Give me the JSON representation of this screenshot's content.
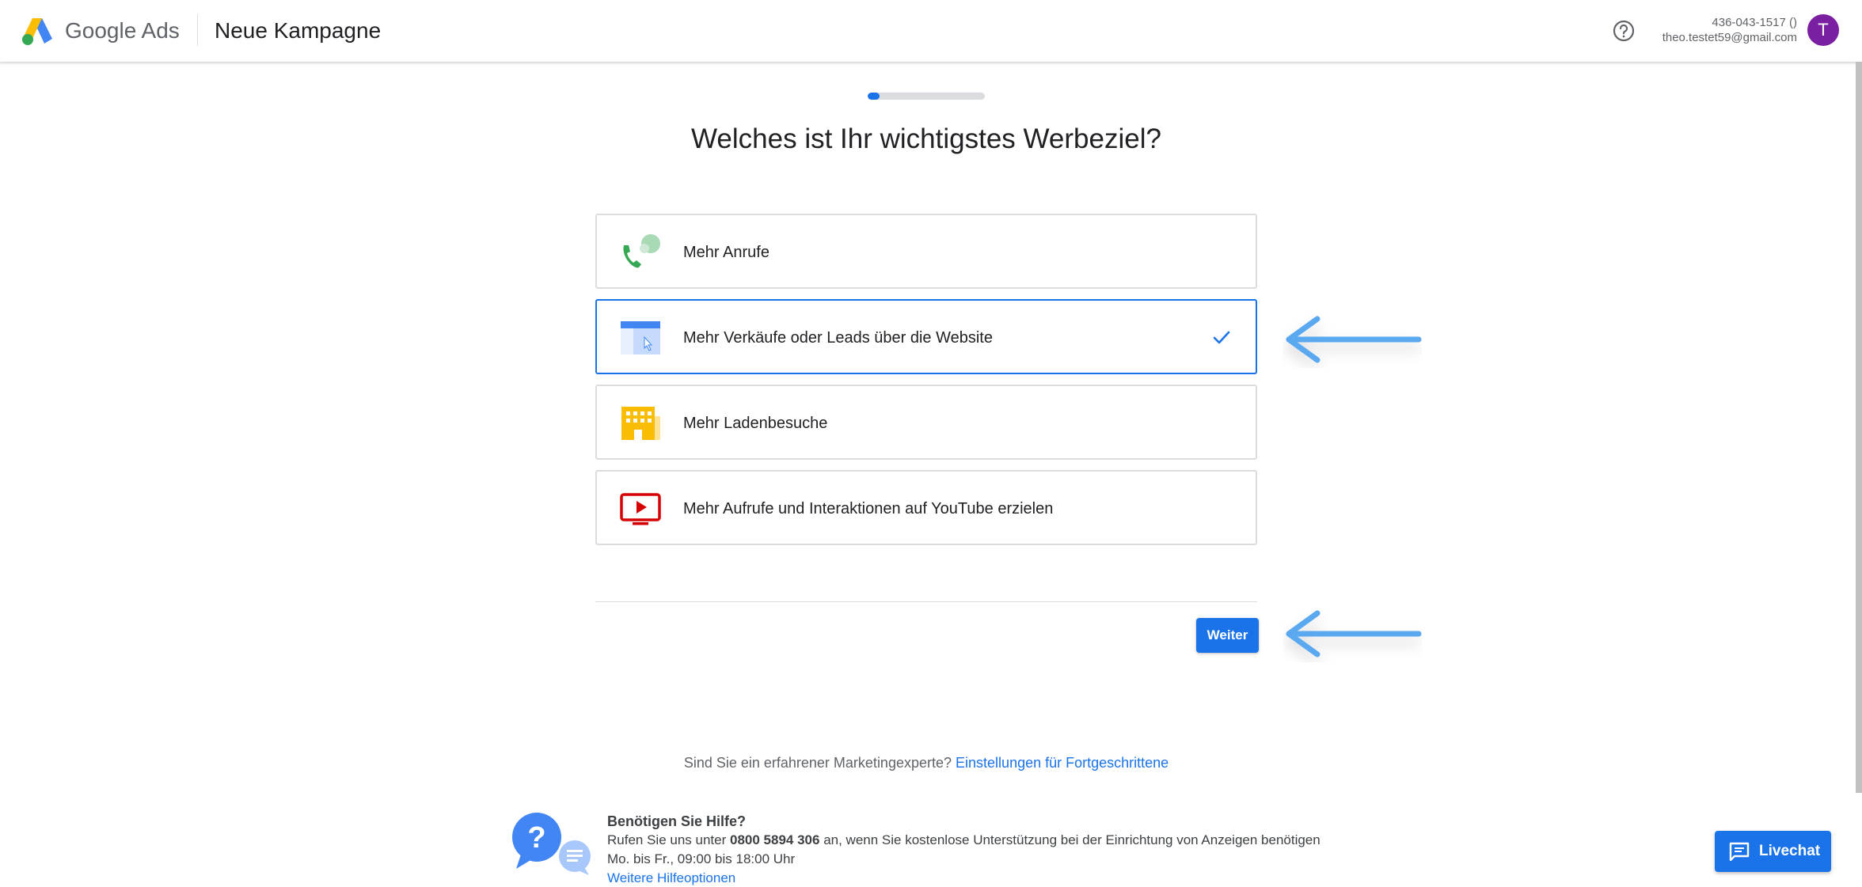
{
  "header": {
    "brand_google": "Google",
    "brand_ads": "Ads",
    "title": "Neue Kampagne",
    "account_id": "436-043-1517 ()",
    "account_email": "theo.testet59@gmail.com",
    "avatar_letter": "T"
  },
  "progress": {
    "step_fraction": 0.1
  },
  "question": "Welches ist Ihr wichtigstes Werbeziel?",
  "options": [
    {
      "label": "Mehr Anrufe",
      "icon": "phone-call-icon",
      "selected": false
    },
    {
      "label": "Mehr Verkäufe oder Leads über die Website",
      "icon": "website-cursor-icon",
      "selected": true
    },
    {
      "label": "Mehr Ladenbesuche",
      "icon": "store-building-icon",
      "selected": false
    },
    {
      "label": "Mehr Aufrufe und Interaktionen auf YouTube erzielen",
      "icon": "youtube-play-icon",
      "selected": false
    }
  ],
  "actions": {
    "next_label": "Weiter"
  },
  "advanced": {
    "prompt": "Sind Sie ein erfahrener Marketingexperte?",
    "link": "Einstellungen für Fortgeschrittene"
  },
  "help": {
    "title": "Benötigen Sie Hilfe?",
    "line1_prefix": "Rufen Sie uns unter",
    "phone": "0800 5894 306",
    "line1_suffix": "an, wenn Sie kostenlose Unterstützung bei der Einrichtung von Anzeigen benötigen",
    "hours": "Mo. bis Fr., 09:00 bis 18:00 Uhr",
    "more_link": "Weitere Hilfeoptionen"
  },
  "livechat": {
    "label": "Livechat"
  },
  "colors": {
    "accent": "#1a73e8",
    "annotation_arrow": "#5aa9f0",
    "avatar": "#7b1fa2"
  }
}
